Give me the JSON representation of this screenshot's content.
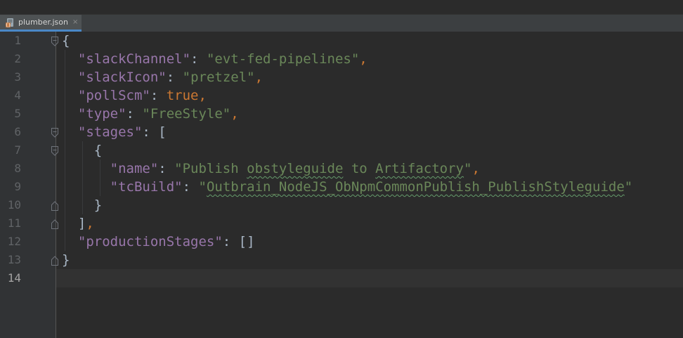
{
  "tab": {
    "filename": "plumber.json",
    "close_glyph": "×",
    "icon": "json-file-icon"
  },
  "editor": {
    "current_line": 14,
    "line_numbers": [
      "1",
      "2",
      "3",
      "4",
      "5",
      "6",
      "7",
      "8",
      "9",
      "10",
      "11",
      "12",
      "13",
      "14"
    ],
    "lines": [
      [
        {
          "t": "{",
          "c": "plain"
        }
      ],
      [
        {
          "t": "  ",
          "c": "plain"
        },
        {
          "t": "\"slackChannel\"",
          "c": "key"
        },
        {
          "t": ": ",
          "c": "plain"
        },
        {
          "t": "\"evt-fed-pipelines\"",
          "c": "str"
        },
        {
          "t": ",",
          "c": "punc"
        }
      ],
      [
        {
          "t": "  ",
          "c": "plain"
        },
        {
          "t": "\"slackIcon\"",
          "c": "key"
        },
        {
          "t": ": ",
          "c": "plain"
        },
        {
          "t": "\"pretzel\"",
          "c": "str"
        },
        {
          "t": ",",
          "c": "punc"
        }
      ],
      [
        {
          "t": "  ",
          "c": "plain"
        },
        {
          "t": "\"pollScm\"",
          "c": "key"
        },
        {
          "t": ": ",
          "c": "plain"
        },
        {
          "t": "true",
          "c": "kw"
        },
        {
          "t": ",",
          "c": "punc"
        }
      ],
      [
        {
          "t": "  ",
          "c": "plain"
        },
        {
          "t": "\"type\"",
          "c": "key"
        },
        {
          "t": ": ",
          "c": "plain"
        },
        {
          "t": "\"FreeStyle\"",
          "c": "str"
        },
        {
          "t": ",",
          "c": "punc"
        }
      ],
      [
        {
          "t": "  ",
          "c": "plain"
        },
        {
          "t": "\"stages\"",
          "c": "key"
        },
        {
          "t": ": [",
          "c": "plain"
        }
      ],
      [
        {
          "t": "    {",
          "c": "plain"
        }
      ],
      [
        {
          "t": "      ",
          "c": "plain"
        },
        {
          "t": "\"name\"",
          "c": "key"
        },
        {
          "t": ": ",
          "c": "plain"
        },
        {
          "t": "\"Publish ",
          "c": "str"
        },
        {
          "t": "obstyleguide",
          "c": "str typo"
        },
        {
          "t": " to ",
          "c": "str"
        },
        {
          "t": "Artifactory",
          "c": "str typo"
        },
        {
          "t": "\"",
          "c": "str"
        },
        {
          "t": ",",
          "c": "punc"
        }
      ],
      [
        {
          "t": "      ",
          "c": "plain"
        },
        {
          "t": "\"tcBuild\"",
          "c": "key"
        },
        {
          "t": ": ",
          "c": "plain"
        },
        {
          "t": "\"",
          "c": "str"
        },
        {
          "t": "Outbrain_NodeJS_ObNpmCommonPublish_PublishStyleguide",
          "c": "str typo"
        },
        {
          "t": "\"",
          "c": "str"
        }
      ],
      [
        {
          "t": "    }",
          "c": "plain"
        }
      ],
      [
        {
          "t": "  ]",
          "c": "plain"
        },
        {
          "t": ",",
          "c": "punc"
        }
      ],
      [
        {
          "t": "  ",
          "c": "plain"
        },
        {
          "t": "\"productionStages\"",
          "c": "key"
        },
        {
          "t": ": []",
          "c": "plain"
        }
      ],
      [
        {
          "t": "}",
          "c": "plain"
        }
      ],
      [
        {
          "t": "",
          "c": "plain"
        }
      ]
    ],
    "fold_markers": [
      {
        "line": 1,
        "kind": "open"
      },
      {
        "line": 6,
        "kind": "open"
      },
      {
        "line": 7,
        "kind": "open"
      },
      {
        "line": 10,
        "kind": "close"
      },
      {
        "line": 11,
        "kind": "close"
      },
      {
        "line": 13,
        "kind": "close"
      }
    ]
  },
  "colors": {
    "key": "#9876aa",
    "string": "#6a8759",
    "keyword": "#cc7832",
    "text": "#a9b7c6",
    "tab_accent": "#4a88c7"
  }
}
